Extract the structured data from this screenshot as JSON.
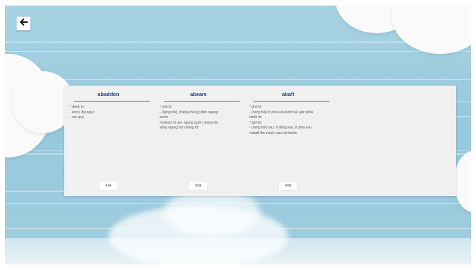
{
  "header": {
    "back_icon": "arrow-left-icon"
  },
  "cards": [
    {
      "word": "abaddon",
      "lines": [
        "* danh từ",
        "- âm ti, địa ngục",
        "- con quỷ"
      ],
      "delete_label": "Xóa"
    },
    {
      "word": "abeam",
      "lines": [
        "* phó từ",
        "- (hàng hải), (hàng không) đâm ngang",
        "sườn",
        "=abeam of us+ ngang sườn chúng tôi;",
        "sóng ngang với chúng tôi"
      ],
      "delete_label": "Xóa"
    },
    {
      "word": "abaft",
      "lines": [
        "* phó từ",
        "- (hàng hải) ở phía sau bánh lái, gần phía",
        "bánh lái",
        "* giới từ",
        "- (hàng hải) sau, ở đằng sau, ở phía sau",
        "=abaft the mast+ sau cột buồm"
      ],
      "delete_label": "Xóa"
    }
  ]
}
